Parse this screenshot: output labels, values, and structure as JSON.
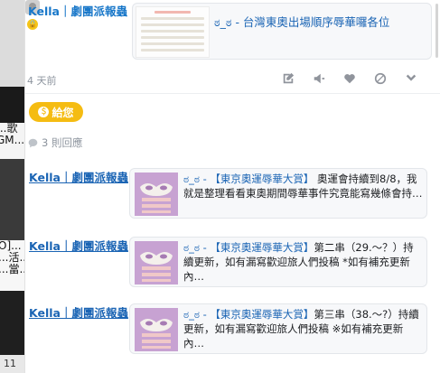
{
  "backdrop": {
    "fragments_left_mid": [
      "...歌",
      "GM..."
    ],
    "fragments_left_low": [
      "O]...",
      "...活...",
      "...當..."
    ],
    "fragment_bottom": "11"
  },
  "post": {
    "author": "Kella｜劇團派報蟲",
    "card_title": "ಠ_ಠ - 台灣東奧出場順序辱華囉各位",
    "time": "4 天前",
    "give_label": "給您",
    "reply_count": "3 則回應"
  },
  "actions": [
    "edit-icon",
    "announce-icon",
    "heart-icon",
    "block-icon",
    "chevron-down-icon"
  ],
  "replies": [
    {
      "author": "Kella｜劇團派報蟲",
      "title": "ಠ_ಠ - 【東京奧運辱華大賞】",
      "body": " 奧運會持續到8/8，我就是整理看看東奧期間辱華事件究竟能寫幾條會持…"
    },
    {
      "author": "Kella｜劇團派報蟲",
      "title": "ಠ_ಠ - 【東京奧運辱華大賞】",
      "body": "第二串（29.～？）持續更新，如有漏寫歡迎旅人們投稿 *如有補充更新內…"
    },
    {
      "author": "Kella｜劇團派報蟲",
      "title": "ಠ_ಠ - 【東京奧運辱華大賞】",
      "body": "第三串（38.～?）持續更新，如有漏寫歡迎旅人們投稿 ※如有補充更新內…"
    }
  ],
  "colors": {
    "link": "#1a64b4",
    "gold": "#f5bc12",
    "muted": "#8d949e"
  }
}
